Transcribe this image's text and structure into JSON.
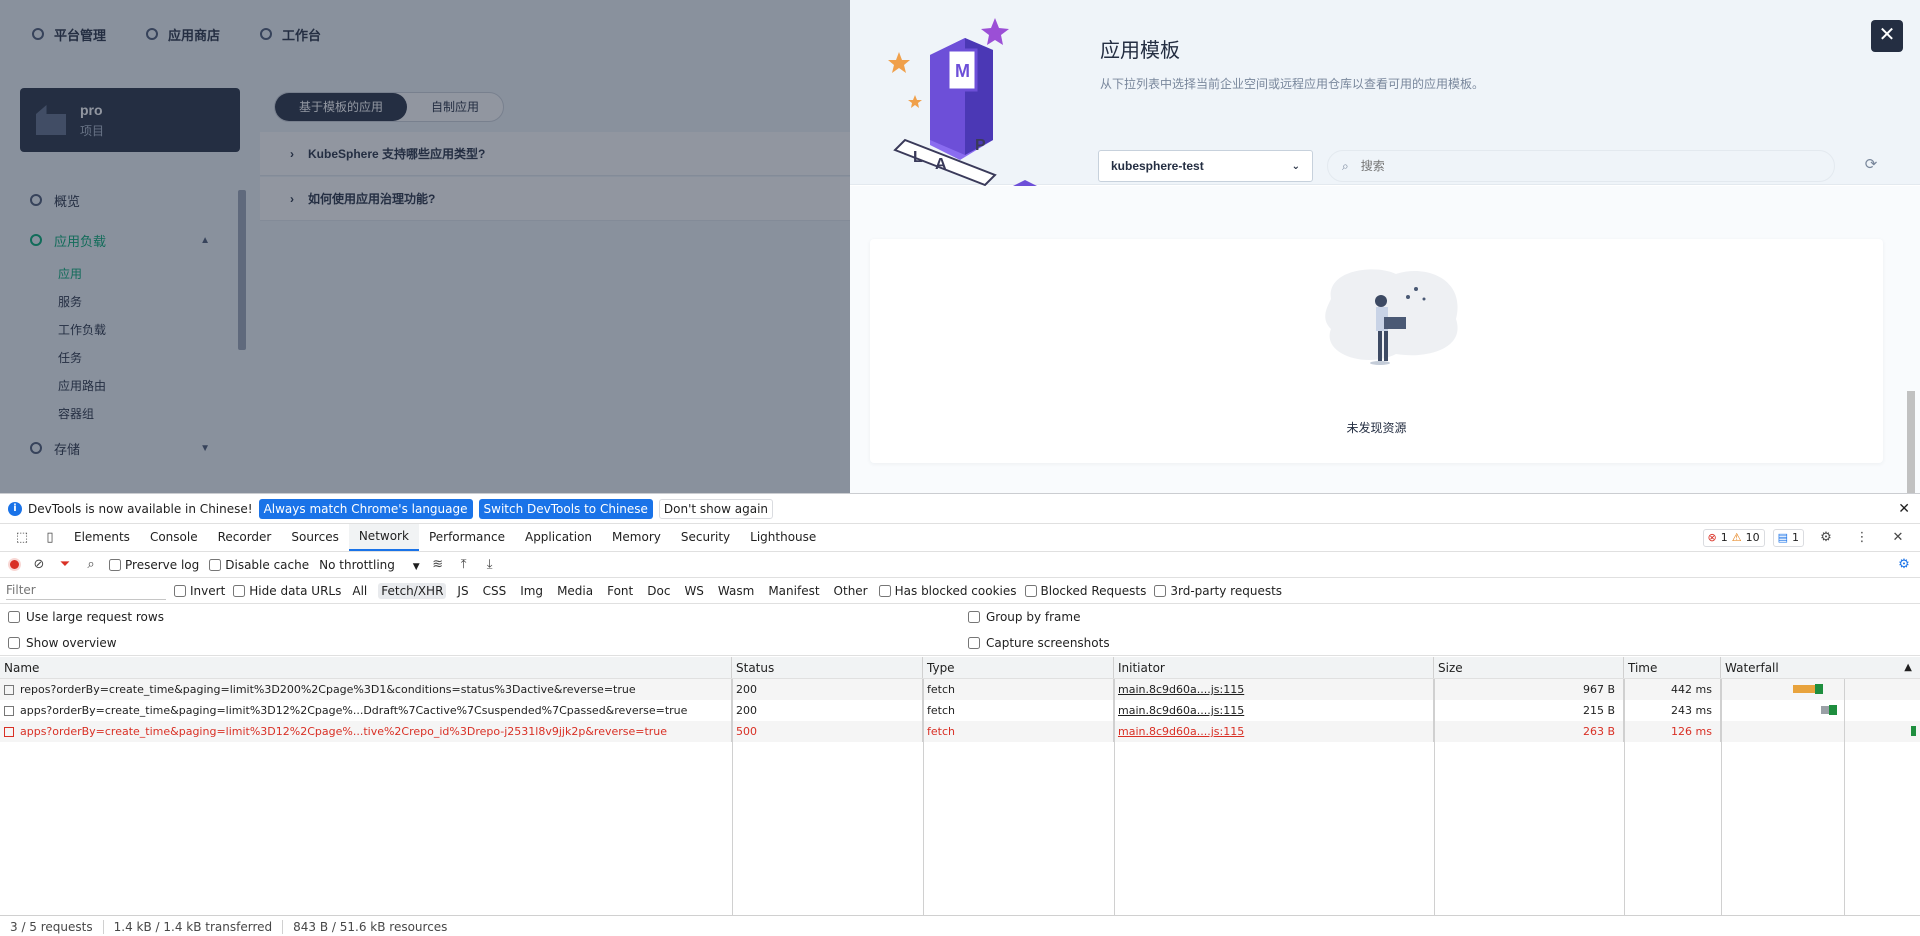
{
  "topnav": {
    "items": [
      "平台管理",
      "应用商店",
      "工作台"
    ]
  },
  "project": {
    "name": "pro",
    "type": "项目"
  },
  "sidebar": {
    "overview": "概览",
    "workloads_group": "应用负载",
    "workloads_items": [
      "应用",
      "服务",
      "工作负载",
      "任务",
      "应用路由",
      "容器组"
    ],
    "storage": "存储"
  },
  "main": {
    "tabs": [
      "基于模板的应用",
      "自制应用"
    ],
    "faq": [
      "KubeSphere 支持哪些应用类型?",
      "如何使用应用治理功能?"
    ]
  },
  "modal": {
    "title": "应用模板",
    "description": "从下拉列表中选择当前企业空间或远程应用仓库以查看可用的应用模板。",
    "repo_selected": "kubesphere-test",
    "search_placeholder": "搜索",
    "empty_text": "未发现资源",
    "close_label": "✕"
  },
  "devtools": {
    "infobar": {
      "message": "DevTools is now available in Chinese!",
      "btn_match": "Always match Chrome's language",
      "btn_switch": "Switch DevTools to Chinese",
      "btn_dismiss": "Don't show again"
    },
    "tabs": [
      "Elements",
      "Console",
      "Recorder",
      "Sources",
      "Network",
      "Performance",
      "Application",
      "Memory",
      "Security",
      "Lighthouse"
    ],
    "active_tab": "Network",
    "counts": {
      "errors": "1",
      "warnings": "10",
      "messages": "1"
    },
    "toolbar": {
      "preserve_log": "Preserve log",
      "disable_cache": "Disable cache",
      "throttling": "No throttling"
    },
    "filter": {
      "placeholder": "Filter",
      "invert": "Invert",
      "hide_data_urls": "Hide data URLs",
      "types": [
        "All",
        "Fetch/XHR",
        "JS",
        "CSS",
        "Img",
        "Media",
        "Font",
        "Doc",
        "WS",
        "Wasm",
        "Manifest",
        "Other"
      ],
      "active_type": "Fetch/XHR",
      "has_blocked_cookies": "Has blocked cookies",
      "blocked_requests": "Blocked Requests",
      "third_party": "3rd-party requests"
    },
    "options": {
      "large_rows": "Use large request rows",
      "show_overview": "Show overview",
      "group_by_frame": "Group by frame",
      "capture_screenshots": "Capture screenshots"
    },
    "columns": [
      "Name",
      "Status",
      "Type",
      "Initiator",
      "Size",
      "Time",
      "Waterfall"
    ],
    "rows": [
      {
        "name": "repos?orderBy=create_time&paging=limit%3D200%2Cpage%3D1&conditions=status%3Dactive&reverse=true",
        "status": "200",
        "type": "fetch",
        "initiator": "main.8c9d60a....js:115",
        "size": "967 B",
        "time": "442 ms",
        "error": false
      },
      {
        "name": "apps?orderBy=create_time&paging=limit%3D12%2Cpage%...Ddraft%7Cactive%7Csuspended%7Cpassed&reverse=true",
        "status": "200",
        "type": "fetch",
        "initiator": "main.8c9d60a....js:115",
        "size": "215 B",
        "time": "243 ms",
        "error": false
      },
      {
        "name": "apps?orderBy=create_time&paging=limit%3D12%2Cpage%...tive%2Crepo_id%3Drepo-j2531l8v9jjk2p&reverse=true",
        "status": "500",
        "type": "fetch",
        "initiator": "main.8c9d60a....js:115",
        "size": "263 B",
        "time": "126 ms",
        "error": true
      }
    ],
    "status": {
      "requests": "3 / 5 requests",
      "transferred": "1.4 kB / 1.4 kB transferred",
      "resources": "843 B / 51.6 kB resources"
    }
  }
}
